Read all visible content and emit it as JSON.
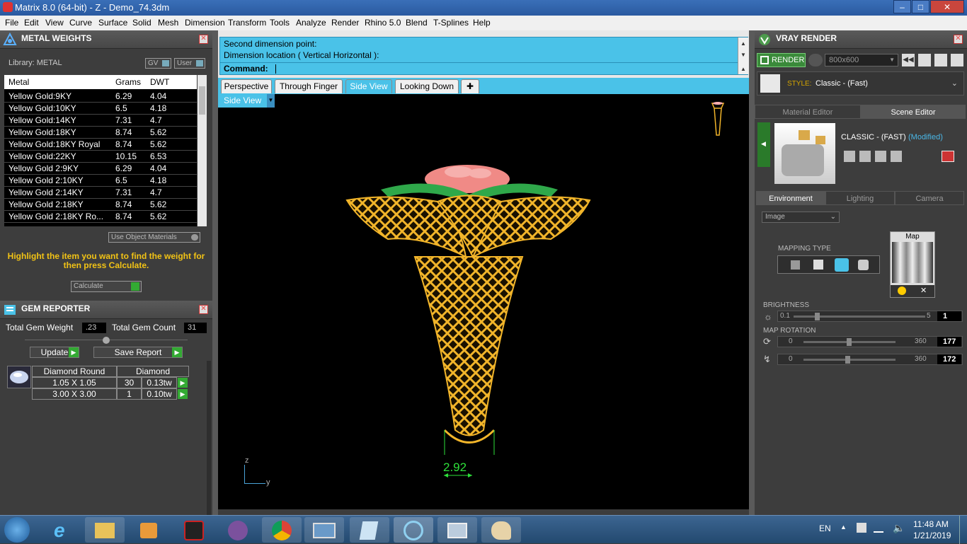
{
  "window": {
    "title": "Matrix 8.0 (64-bit) - Z - Demo_74.3dm"
  },
  "menu": [
    "File",
    "Edit",
    "View",
    "Curve",
    "Surface",
    "Solid",
    "Mesh",
    "Dimension",
    "Transform",
    "Tools",
    "Analyze",
    "Render",
    "Rhino 5.0",
    "Blend",
    "T-Splines",
    "Help"
  ],
  "metal_weights": {
    "title": "METAL WEIGHTS",
    "library": "Library: METAL",
    "gv": "GV",
    "user": "User",
    "headers": [
      "Metal",
      "Grams",
      "DWT"
    ],
    "rows": [
      [
        "Yellow Gold:9KY",
        "6.29",
        "4.04"
      ],
      [
        "Yellow Gold:10KY",
        "6.5",
        "4.18"
      ],
      [
        "Yellow Gold:14KY",
        "7.31",
        "4.7"
      ],
      [
        "Yellow Gold:18KY",
        "8.74",
        "5.62"
      ],
      [
        "Yellow Gold:18KY Royal",
        "8.74",
        "5.62"
      ],
      [
        "Yellow Gold:22KY",
        "10.15",
        "6.53"
      ],
      [
        "Yellow Gold 2:9KY",
        "6.29",
        "4.04"
      ],
      [
        "Yellow Gold 2:10KY",
        "6.5",
        "4.18"
      ],
      [
        "Yellow Gold 2:14KY",
        "7.31",
        "4.7"
      ],
      [
        "Yellow Gold 2:18KY",
        "8.74",
        "5.62"
      ],
      [
        "Yellow Gold 2:18KY Ro...",
        "8.74",
        "5.62"
      ]
    ],
    "use_object_materials": "Use Object Materials",
    "hint": "Highlight the item you want to find the weight for then press Calculate.",
    "calculate": "Calculate"
  },
  "gem_reporter": {
    "title": "GEM REPORTER",
    "total_weight_label": "Total Gem Weight",
    "total_weight": ".23",
    "total_count_label": "Total Gem Count",
    "total_count": "31",
    "update": "Update",
    "save_report": "Save Report",
    "col1": "Diamond Round",
    "col2": "Diamond",
    "gems": [
      {
        "size": "1.05 X 1.05",
        "count": "30",
        "weight": "0.13tw"
      },
      {
        "size": "3.00 X 3.00",
        "count": "1",
        "weight": "0.10tw"
      }
    ]
  },
  "command": {
    "line1": "Second dimension point:",
    "line2": "Dimension location ( Vertical  Horizontal ):",
    "prompt": "Command:"
  },
  "viewport_tabs": [
    "Perspective",
    "Through Finger",
    "Side View",
    "Looking Down"
  ],
  "active_tab": "Side View",
  "viewport": {
    "name": "Side View",
    "dimension": "2.92",
    "axis_z": "z",
    "axis_y": "y"
  },
  "vray": {
    "title": "VRAY RENDER",
    "render": "RENDER",
    "resolution": "800x600",
    "style_label": "STYLE:",
    "style_value": "Classic - (Fast)",
    "editor_tabs": [
      "Material Editor",
      "Scene Editor"
    ],
    "scene_name": "CLASSIC - (FAST)",
    "modified": "(Modified)",
    "env_tabs": [
      "Environment",
      "Lighting",
      "Camera"
    ],
    "env_type": "Image",
    "mapping_type": "MAPPING TYPE",
    "map": "Map",
    "brightness_label": "BRIGHTNESS",
    "brightness": {
      "min": "0.1",
      "max": "5",
      "value": "1"
    },
    "map_rotation_label": "MAP ROTATION",
    "rotation1": {
      "min": "0",
      "max": "360",
      "value": "177"
    },
    "rotation2": {
      "min": "0",
      "max": "360",
      "value": "172"
    }
  },
  "taskbar": {
    "lang": "EN",
    "time": "11:48 AM",
    "date": "1/21/2019"
  },
  "colors": {
    "accent": "#4ac2e8",
    "gold": "#f2b52a",
    "hint": "#f2c315",
    "dimension": "#2ee03a"
  }
}
